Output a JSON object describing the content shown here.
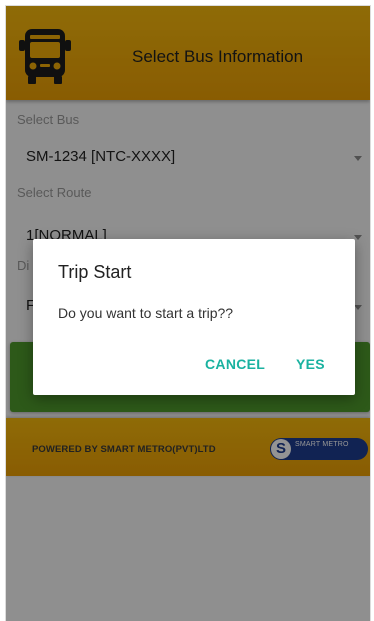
{
  "header": {
    "title": "Select Bus Information",
    "icon": "bus-icon"
  },
  "form": {
    "bus_label": "Select Bus",
    "bus_value": "SM-1234 [NTC-XXXX]",
    "route_label": "Select Route",
    "route_value": "1[NORMAL]",
    "third_label_partial": "Di",
    "third_value_partial": "F"
  },
  "footer": {
    "powered_text": "POWERED BY SMART METRO(PVT)LTD",
    "logo_letter": "S",
    "logo_text": "SMART METRO"
  },
  "dialog": {
    "title": "Trip Start",
    "message": "Do you want to start a trip??",
    "cancel_label": "CANCEL",
    "yes_label": "YES"
  },
  "colors": {
    "header": "#f2ad08",
    "start_button": "#4f9a2c",
    "dialog_accent": "#1ab2a0",
    "logo": "#1e3d8f"
  }
}
